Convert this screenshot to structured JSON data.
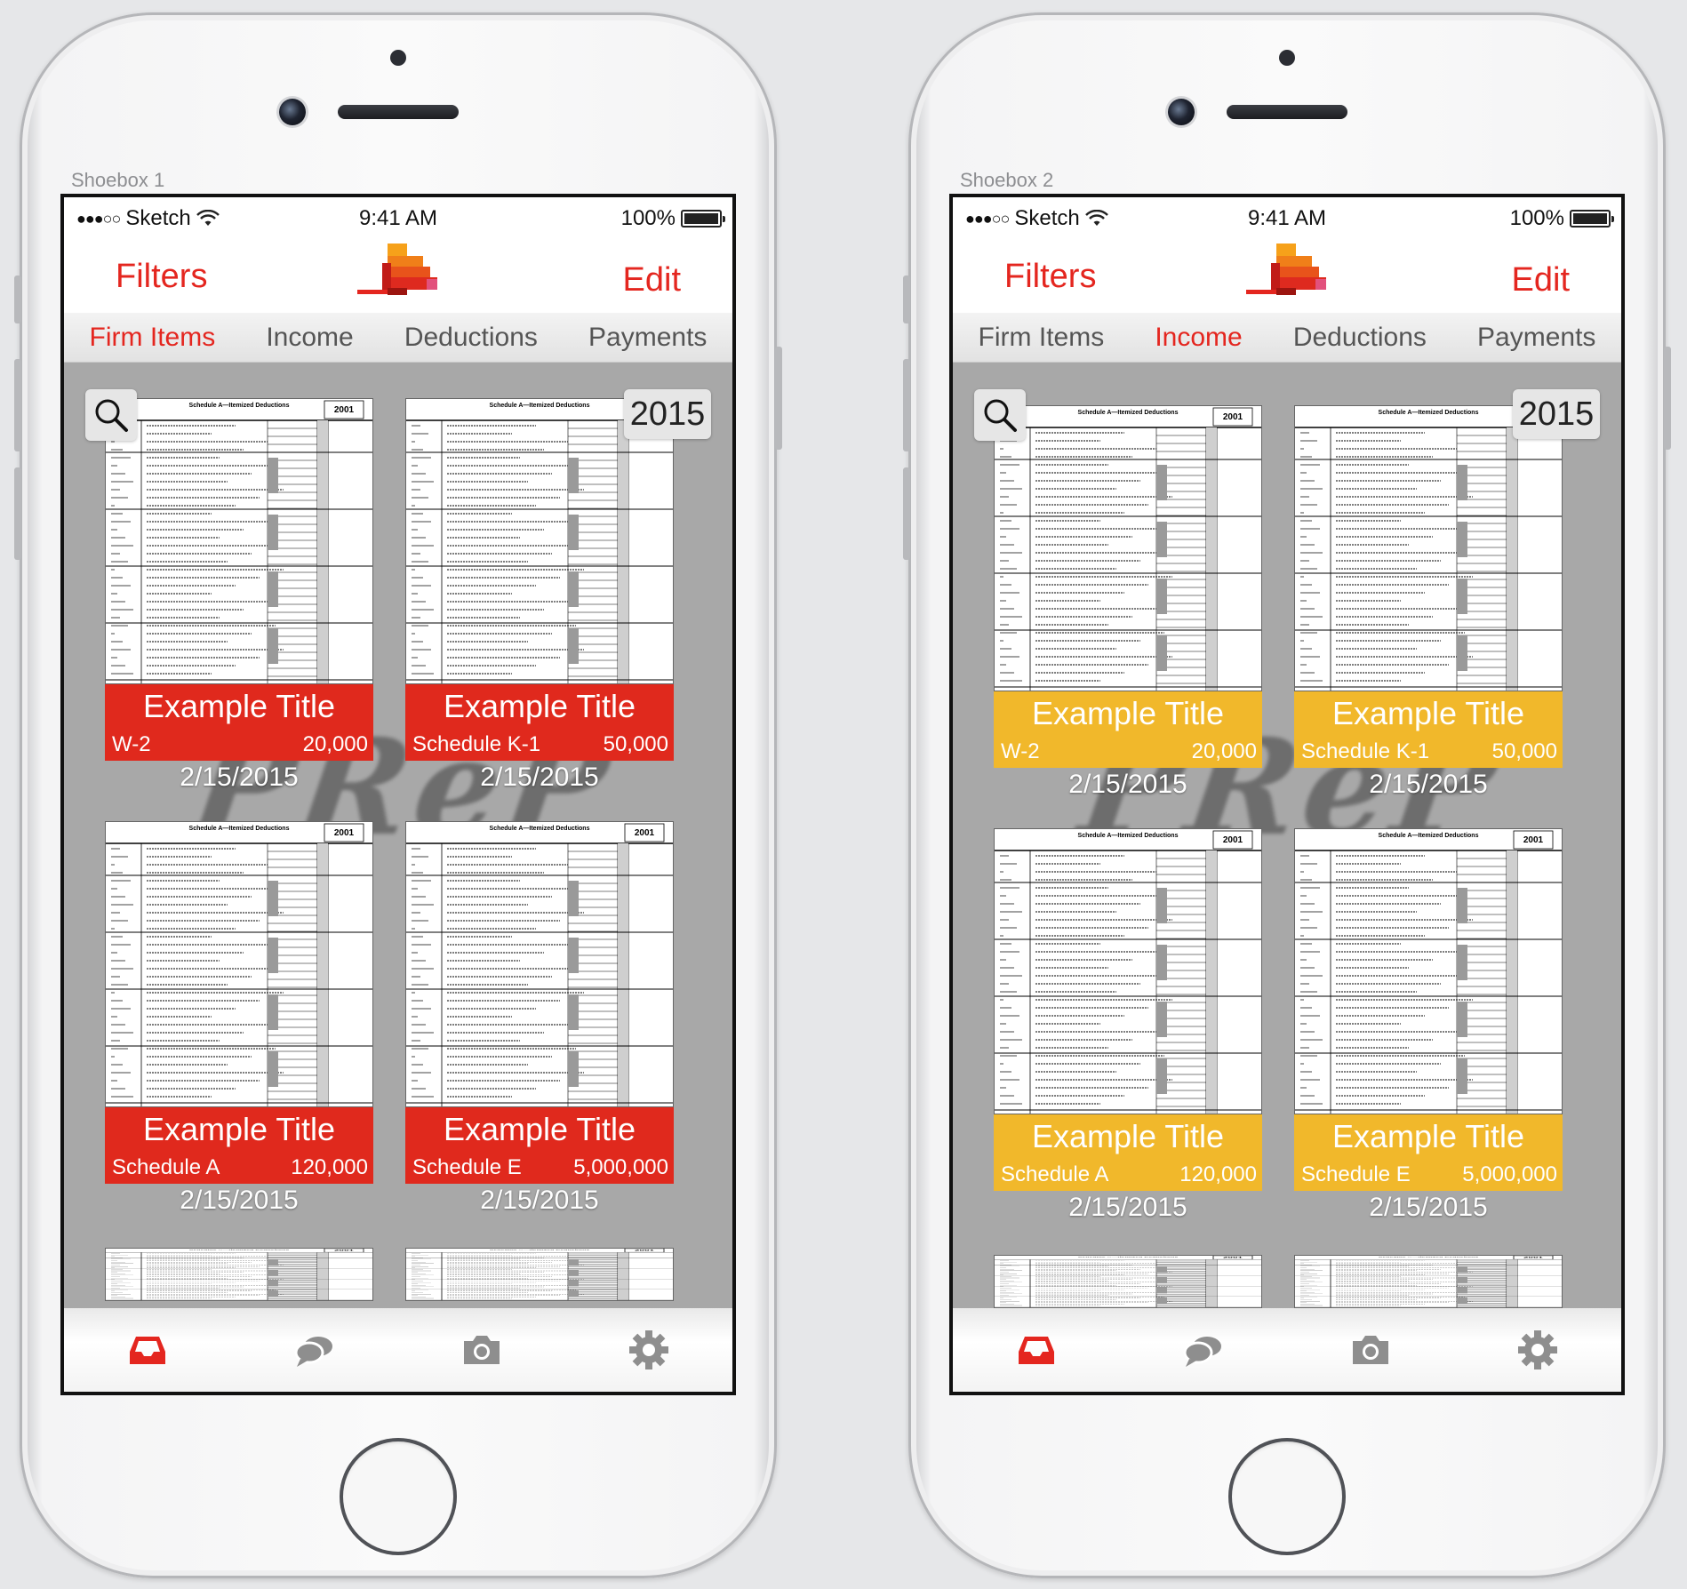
{
  "devices": [
    {
      "label": "Shoebox 1",
      "status": {
        "carrier": "Sketch",
        "time": "9:41 AM",
        "battery": "100%"
      },
      "nav": {
        "left": "Filters",
        "right": "Edit"
      },
      "segments": [
        "Firm Items",
        "Income",
        "Deductions",
        "Payments"
      ],
      "active_segment": "Firm Items",
      "year": "2015",
      "watermark": "PReP",
      "banner_color": "#e0291d",
      "cards": [
        {
          "title": "Example Title",
          "form": "W-2",
          "amount": "20,000",
          "date": "2/15/2015"
        },
        {
          "title": "Example Title",
          "form": "Schedule K-1",
          "amount": "50,000",
          "date": "2/15/2015"
        },
        {
          "title": "Example Title",
          "form": "Schedule A",
          "amount": "120,000",
          "date": "2/15/2015"
        },
        {
          "title": "Example Title",
          "form": "Schedule E",
          "amount": "5,000,000",
          "date": "2/15/2015"
        }
      ]
    },
    {
      "label": "Shoebox 2",
      "status": {
        "carrier": "Sketch",
        "time": "9:41 AM",
        "battery": "100%"
      },
      "nav": {
        "left": "Filters",
        "right": "Edit"
      },
      "segments": [
        "Firm Items",
        "Income",
        "Deductions",
        "Payments"
      ],
      "active_segment": "Income",
      "year": "2015",
      "watermark": "PReP",
      "banner_color": "#f1b82b",
      "cards": [
        {
          "title": "Example Title",
          "form": "W-2",
          "amount": "20,000",
          "date": "2/15/2015"
        },
        {
          "title": "Example Title",
          "form": "Schedule K-1",
          "amount": "50,000",
          "date": "2/15/2015"
        },
        {
          "title": "Example Title",
          "form": "Schedule A",
          "amount": "120,000",
          "date": "2/15/2015"
        },
        {
          "title": "Example Title",
          "form": "Schedule E",
          "amount": "5,000,000",
          "date": "2/15/2015"
        }
      ]
    }
  ],
  "thumbnail": {
    "header": "Schedule A—Itemized Deductions",
    "year": "2001"
  },
  "tab_icons": [
    "inbox-icon",
    "chat-bubbles-icon",
    "camera-icon",
    "gear-icon"
  ],
  "colors": {
    "accent": "#e4261f",
    "inactive_icon": "#8e8e8e"
  }
}
